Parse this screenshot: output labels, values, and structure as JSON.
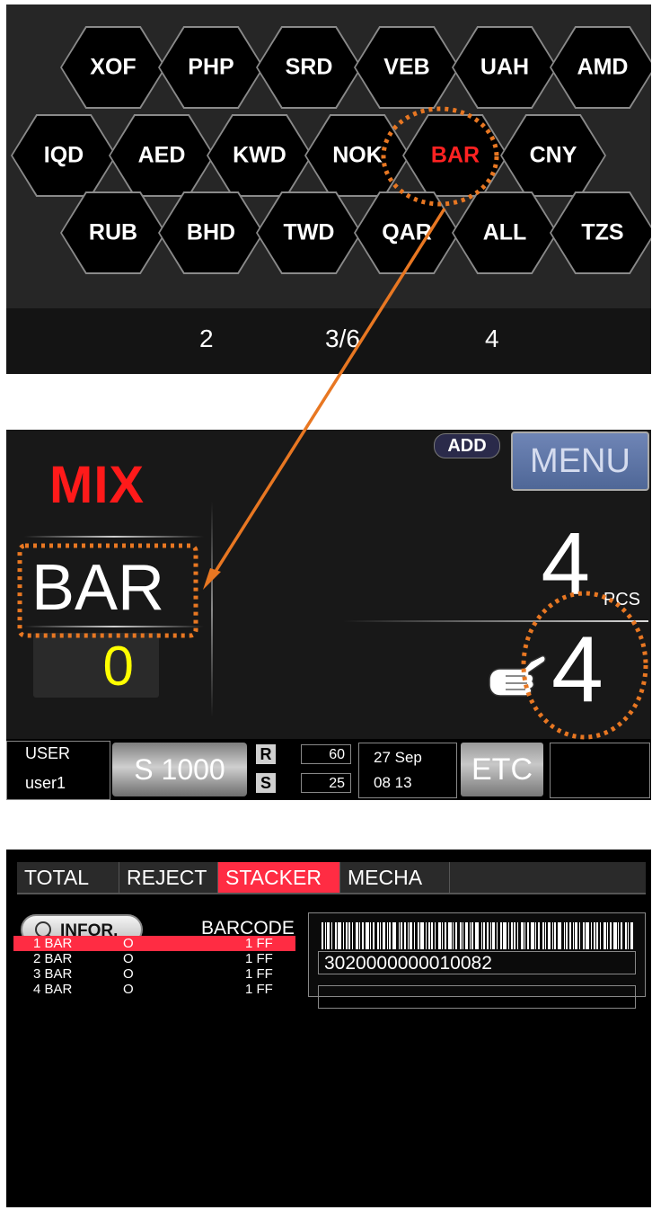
{
  "currency_panel": {
    "rows": [
      [
        "XOF",
        "PHP",
        "SRD",
        "VEB",
        "UAH",
        "AMD"
      ],
      [
        "IQD",
        "AED",
        "KWD",
        "NOK",
        "BAR",
        "CNY"
      ],
      [
        "RUB",
        "BHD",
        "TWD",
        "QAR",
        "ALL",
        "TZS"
      ]
    ],
    "selected": "BAR",
    "selected_color": "#ff2222",
    "pager": {
      "prev": "2",
      "current": "3/6",
      "next": "4"
    }
  },
  "count_screen": {
    "mode": "MIX",
    "currency": "BAR",
    "batch": "0",
    "add_label": "ADD",
    "menu_label": "MENU",
    "total_count": "4",
    "unit": "PCS",
    "batch_count": "4",
    "hand_icon": "pointing-hand-icon",
    "status": {
      "user_label": "USER",
      "user_name": "user1",
      "denomination": "S 1000",
      "r_label": "R",
      "r_value": "60",
      "s_label": "S",
      "s_value": "25",
      "date": "27 Sep",
      "time": "08  13",
      "etc_label": "ETC"
    }
  },
  "stacker_screen": {
    "tabs": [
      "TOTAL",
      "REJECT",
      "STACKER",
      "MECHA"
    ],
    "active_tab": "STACKER",
    "infor_label": "INFOR.",
    "barcode_label": "BARCODE",
    "barcode_value": "3020000000010082",
    "rows": [
      {
        "id": "1 BAR",
        "flag": "O",
        "value": "1 FF",
        "selected": true
      },
      {
        "id": "2 BAR",
        "flag": "O",
        "value": "1 FF",
        "selected": false
      },
      {
        "id": "3 BAR",
        "flag": "O",
        "value": "1 FF",
        "selected": false
      },
      {
        "id": "4 BAR",
        "flag": "O",
        "value": "1 FF",
        "selected": false
      }
    ]
  },
  "colors": {
    "highlight_orange": "#e87722",
    "accent_red": "#ff2c43",
    "batch_yellow": "#ffff00",
    "mix_red": "#ff1a1a"
  }
}
